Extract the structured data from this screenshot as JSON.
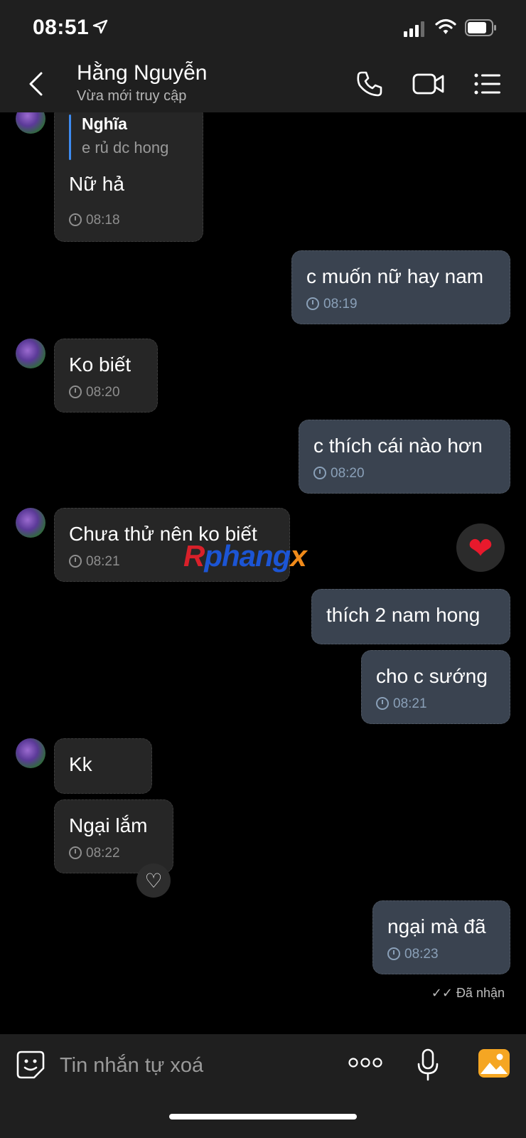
{
  "status": {
    "time": "08:51"
  },
  "header": {
    "contact_name": "Hằng Nguyễn",
    "presence": "Vừa mới truy cập"
  },
  "messages": [
    {
      "from": "them",
      "reply_to": {
        "name": "Nghĩa",
        "text": "e rủ dc hong"
      },
      "text": "Nữ hả",
      "time": "08:18"
    },
    {
      "from": "me",
      "text": "c muốn nữ hay nam",
      "time": "08:19"
    },
    {
      "from": "them",
      "text": "Ko biết",
      "time": "08:20"
    },
    {
      "from": "me",
      "text": "c thích cái nào hơn",
      "time": "08:20"
    },
    {
      "from": "them",
      "text": "Chưa thử nên ko biết",
      "time": "08:21"
    },
    {
      "from": "me",
      "text": "thích 2 nam hong",
      "time": ""
    },
    {
      "from": "me",
      "text": "cho c sướng",
      "time": "08:21"
    },
    {
      "from": "them",
      "text": "Kk",
      "time": ""
    },
    {
      "from": "them",
      "text": "Ngại lắm",
      "time": "08:22"
    },
    {
      "from": "me",
      "text": "ngại mà đã",
      "time": "08:23"
    }
  ],
  "watermark": {
    "part1": "R",
    "part2": "phang",
    "part3": "x"
  },
  "delivery_status": "Đã nhận",
  "composer": {
    "placeholder": "Tin nhắn tự xoá"
  },
  "colors": {
    "incoming": "#262626",
    "outgoing": "#3a4350",
    "accent": "#3d8bf0",
    "heart": "#e8192c"
  }
}
